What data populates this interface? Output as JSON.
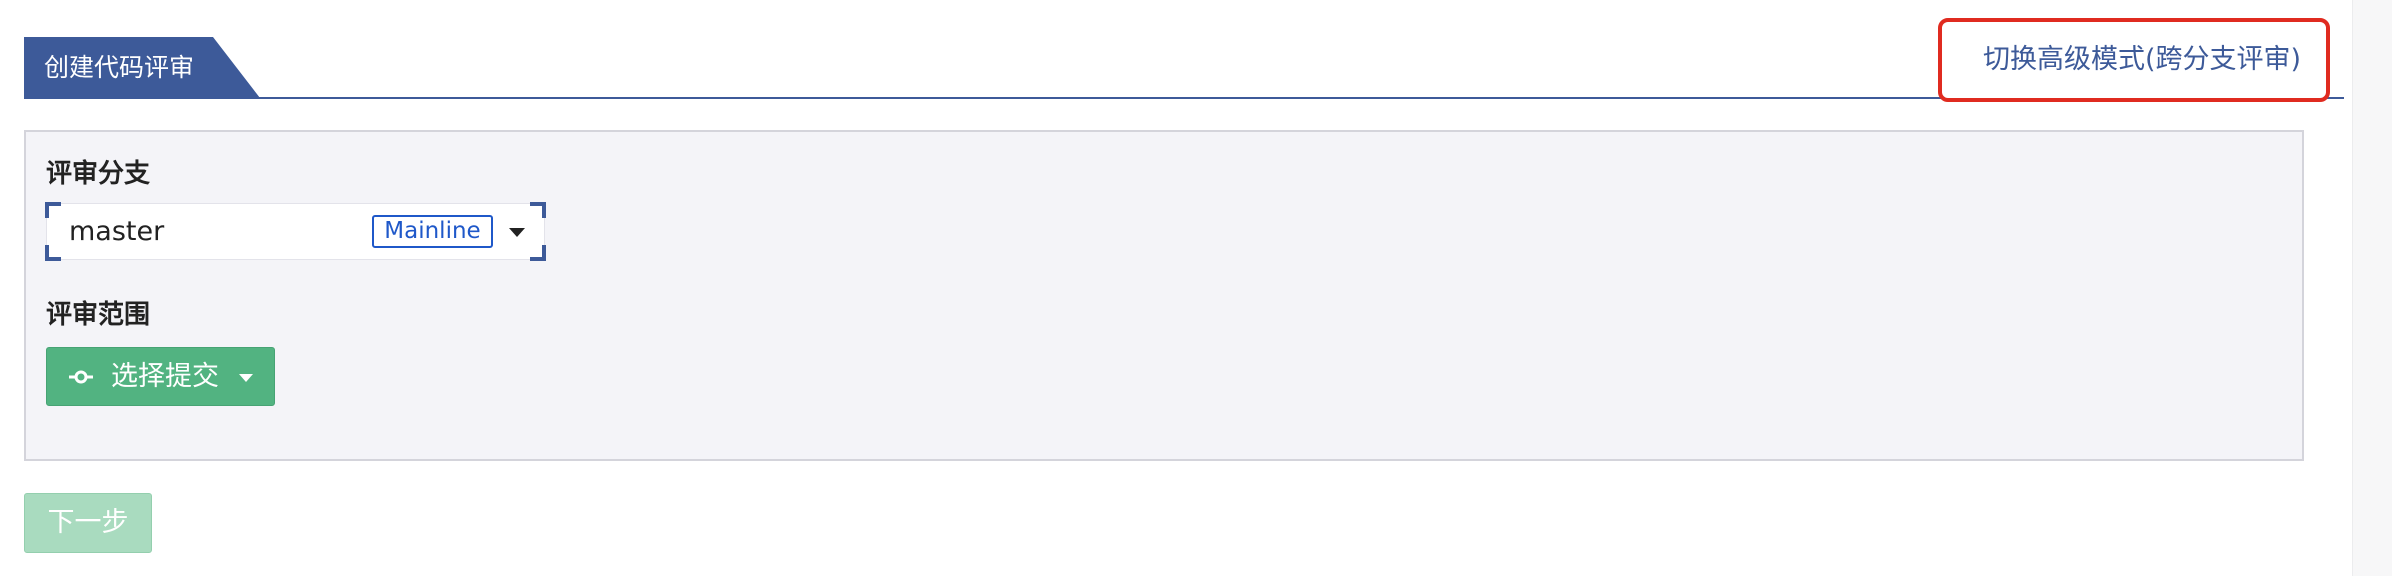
{
  "header": {
    "title": "创建代码评审",
    "advanced_mode_link": "切换高级模式(跨分支评审)"
  },
  "form": {
    "branch": {
      "label": "评审分支",
      "value": "master",
      "badge": "Mainline",
      "caret_icon": "caret-down-icon"
    },
    "scope": {
      "label": "评审范围",
      "button_label": "选择提交",
      "button_icon": "commit-icon",
      "caret_icon": "caret-down-icon"
    }
  },
  "footer": {
    "next_label": "下一步"
  },
  "colors": {
    "primary": "#3d5a99",
    "success": "#52b381",
    "success_disabled": "#a9dbbf",
    "highlight": "#e02b20",
    "badge": "#1f58c9"
  }
}
